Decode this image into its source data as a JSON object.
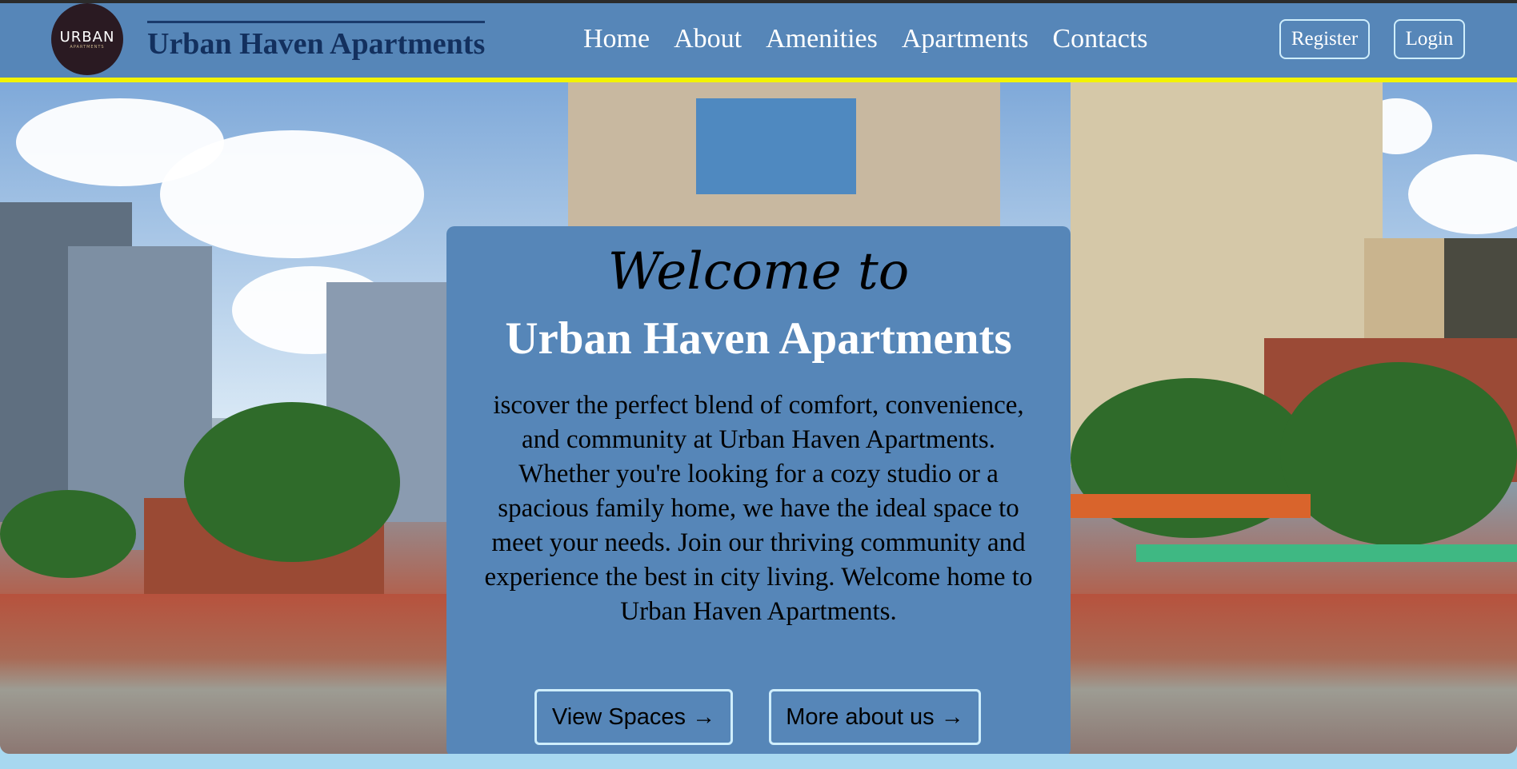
{
  "header": {
    "logo_text": "URBAN",
    "logo_subtext": "APARTMENTS",
    "brand": "Urban Haven Apartments",
    "nav": [
      "Home",
      "About",
      "Amenities",
      "Apartments",
      "Contacts"
    ],
    "register_label": "Register",
    "login_label": "Login"
  },
  "hero": {
    "welcome": "Welcome to",
    "title": "Urban Haven Apartments",
    "description": "iscover the perfect blend of comfort, convenience, and community at Urban Haven Apartments. Whether you're looking for a cozy studio or a spacious family home, we have the ideal space to meet your needs. Join our thriving community and experience the best in city living. Welcome home to Urban Haven Apartments.",
    "view_spaces_label": "View Spaces →",
    "more_about_label": "More about us →"
  },
  "colors": {
    "header_bg": "#5686b8",
    "accent_stripe": "#f3f300",
    "brand_text": "#13305e",
    "button_border": "#cfeefc",
    "page_bg": "#a8d8f0"
  }
}
